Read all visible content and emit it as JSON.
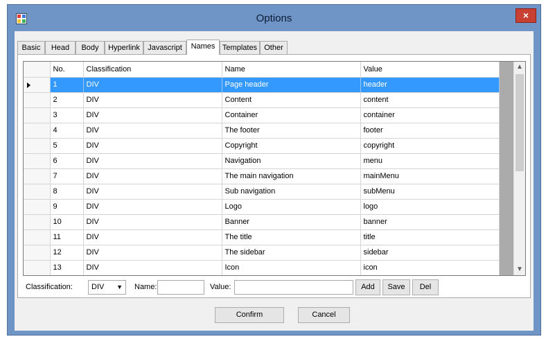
{
  "window": {
    "title": "Options",
    "close_label": "×"
  },
  "tabs": [
    "Basic",
    "Head",
    "Body",
    "Hyperlink",
    "Javascript",
    "Names",
    "Templates",
    "Other"
  ],
  "active_tab": "Names",
  "grid": {
    "columns": [
      "No.",
      "Classification",
      "Name",
      "Value"
    ],
    "rows": [
      {
        "no": "1",
        "classification": "DIV",
        "name": "Page header",
        "value": "header"
      },
      {
        "no": "2",
        "classification": "DIV",
        "name": "Content",
        "value": "content"
      },
      {
        "no": "3",
        "classification": "DIV",
        "name": "Container",
        "value": "container"
      },
      {
        "no": "4",
        "classification": "DIV",
        "name": "The footer",
        "value": "footer"
      },
      {
        "no": "5",
        "classification": "DIV",
        "name": "Copyright",
        "value": "copyright"
      },
      {
        "no": "6",
        "classification": "DIV",
        "name": "Navigation",
        "value": "menu"
      },
      {
        "no": "7",
        "classification": "DIV",
        "name": "The main navigation",
        "value": "mainMenu"
      },
      {
        "no": "8",
        "classification": "DIV",
        "name": "Sub navigation",
        "value": "subMenu"
      },
      {
        "no": "9",
        "classification": "DIV",
        "name": "Logo",
        "value": "logo"
      },
      {
        "no": "10",
        "classification": "DIV",
        "name": "Banner",
        "value": "banner"
      },
      {
        "no": "11",
        "classification": "DIV",
        "name": "The title",
        "value": "title"
      },
      {
        "no": "12",
        "classification": "DIV",
        "name": "The sidebar",
        "value": "sidebar"
      },
      {
        "no": "13",
        "classification": "DIV",
        "name": "Icon",
        "value": "icon"
      }
    ],
    "selected_row": 0
  },
  "form": {
    "classification_label": "Classification:",
    "classification_value": "DIV",
    "name_label": "Name:",
    "name_value": "",
    "value_label": "Value:",
    "value_value": "",
    "add_label": "Add",
    "save_label": "Save",
    "del_label": "Del"
  },
  "footer": {
    "confirm_label": "Confirm",
    "cancel_label": "Cancel"
  },
  "colors": {
    "selection": "#3399ff",
    "frame": "#6f94c6",
    "close": "#c84031"
  }
}
